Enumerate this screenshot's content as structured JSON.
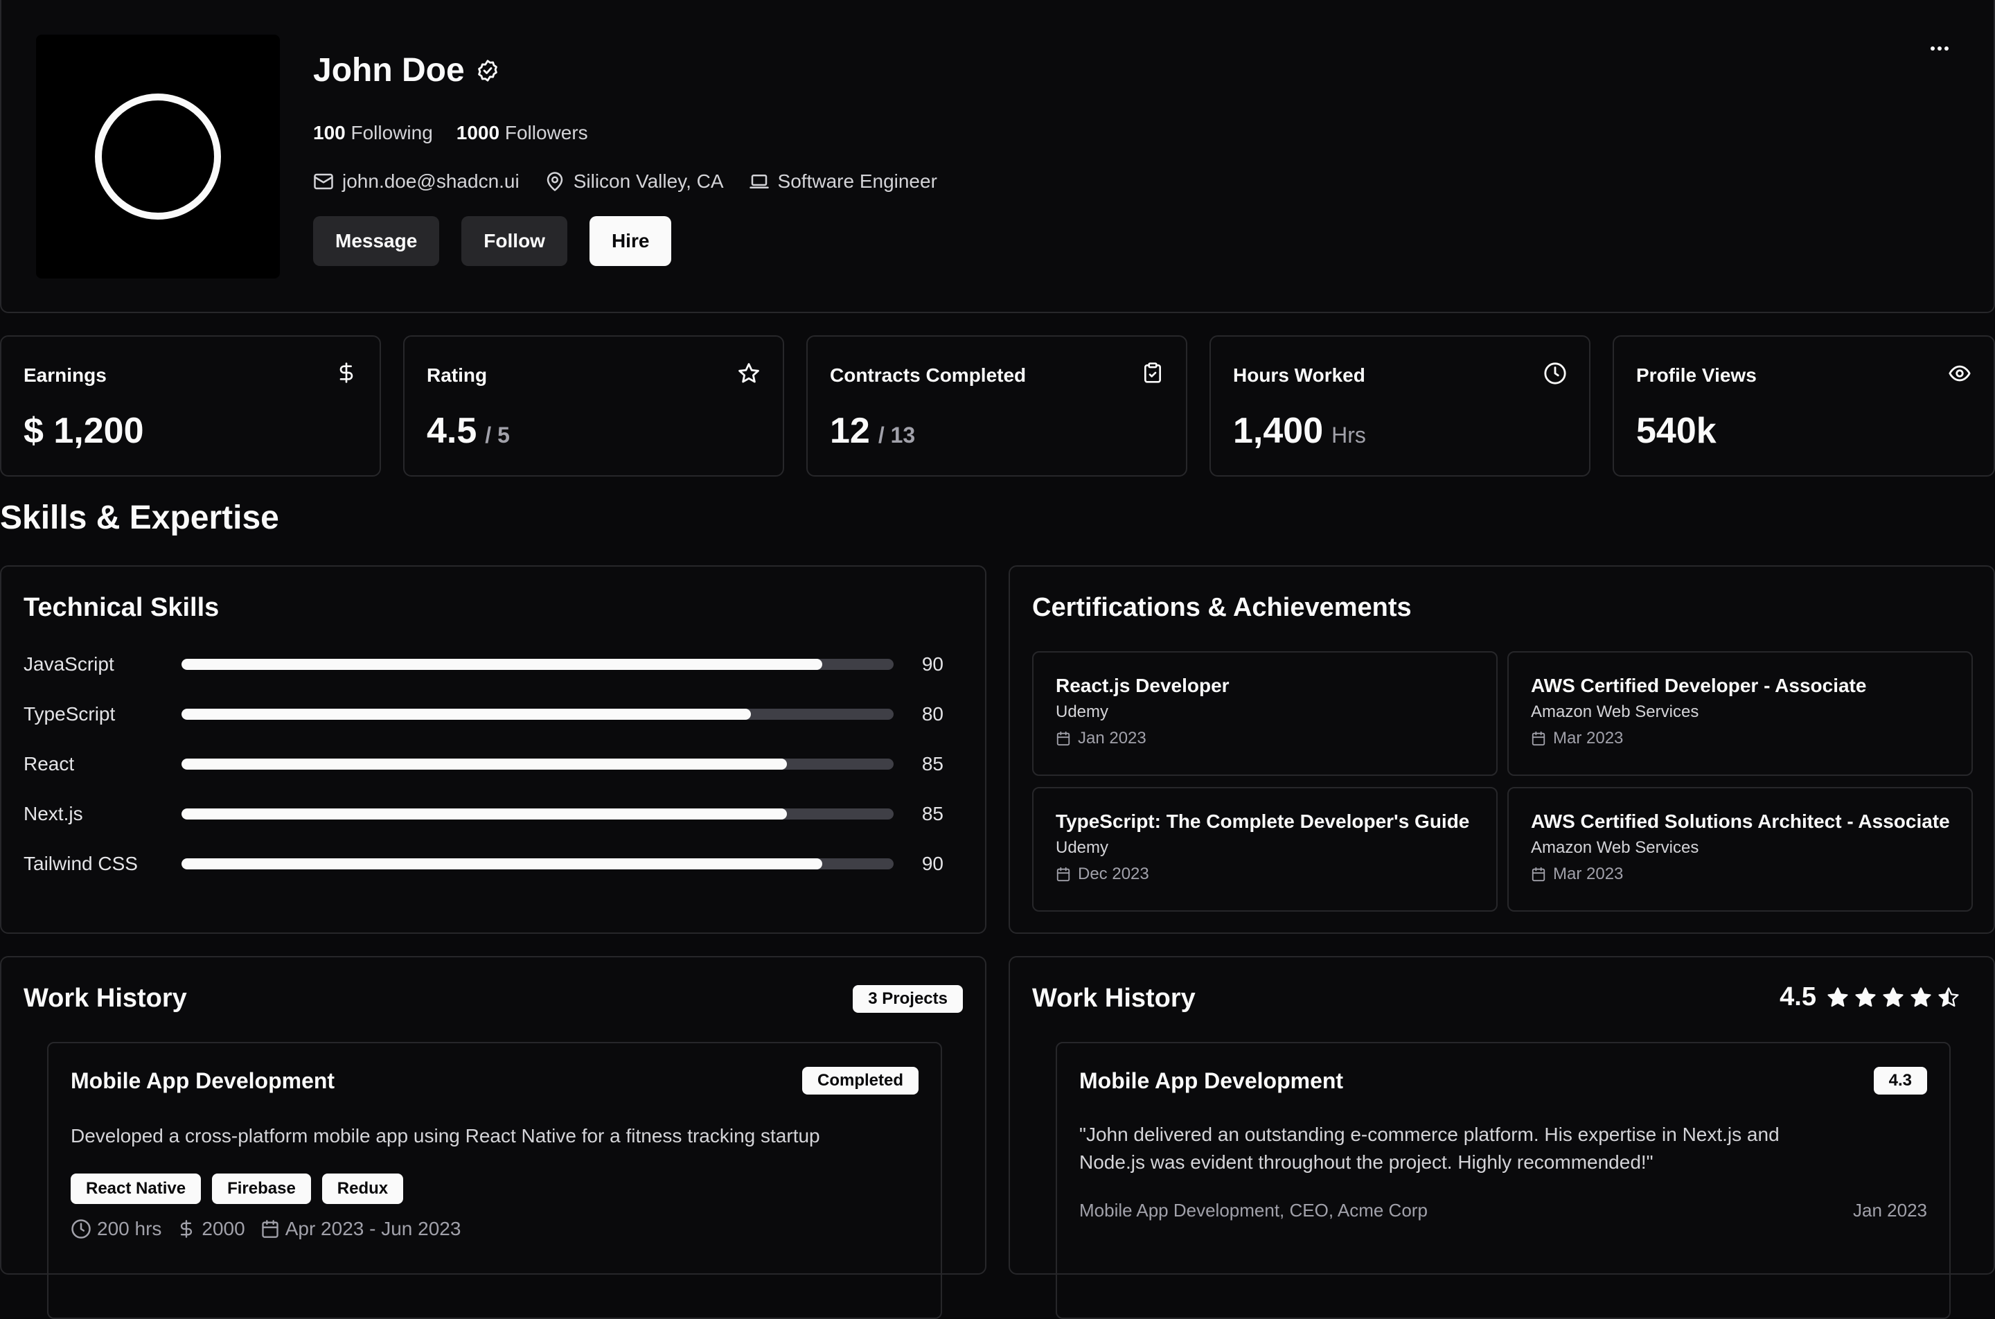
{
  "profile": {
    "name": "John Doe",
    "following_count": "100",
    "following_label": "Following",
    "followers_count": "1000",
    "followers_label": "Followers",
    "email": "john.doe@shadcn.ui",
    "location": "Silicon Valley, CA",
    "role": "Software Engineer",
    "buttons": {
      "message": "Message",
      "follow": "Follow",
      "hire": "Hire"
    }
  },
  "stats": [
    {
      "label": "Earnings",
      "value": "$ 1,200",
      "suffix": "",
      "icon": "dollar-icon"
    },
    {
      "label": "Rating",
      "value": "4.5",
      "suffix": "/ 5",
      "icon": "star-icon"
    },
    {
      "label": "Contracts Completed",
      "value": "12",
      "suffix": "/ 13",
      "icon": "clipboard-check-icon"
    },
    {
      "label": "Hours Worked",
      "value": "1,400",
      "suffix": "Hrs",
      "icon": "clock-icon"
    },
    {
      "label": "Profile Views",
      "value": "540k",
      "suffix": "",
      "icon": "eye-icon"
    }
  ],
  "section_title": "Skills & Expertise",
  "skills": {
    "title": "Technical Skills",
    "items": [
      {
        "name": "JavaScript",
        "level": 90,
        "label": "90"
      },
      {
        "name": "TypeScript",
        "level": 80,
        "label": "80"
      },
      {
        "name": "React",
        "level": 85,
        "label": "85"
      },
      {
        "name": "Next.js",
        "level": 85,
        "label": "85"
      },
      {
        "name": "Tailwind CSS",
        "level": 90,
        "label": "90"
      }
    ]
  },
  "certifications": {
    "title": "Certifications & Achievements",
    "items": [
      {
        "title": "React.js Developer",
        "org": "Udemy",
        "date": "Jan 2023"
      },
      {
        "title": "AWS Certified Developer - Associate",
        "org": "Amazon Web Services",
        "date": "Mar 2023"
      },
      {
        "title": "TypeScript: The Complete Developer's Guide",
        "org": "Udemy",
        "date": "Dec 2023"
      },
      {
        "title": "AWS Certified Solutions Architect - Associate",
        "org": "Amazon Web Services",
        "date": "Mar 2023"
      }
    ]
  },
  "work_history": {
    "title": "Work History",
    "badge": "3 Projects",
    "project": {
      "title": "Mobile App Development",
      "status": "Completed",
      "description": "Developed a cross-platform mobile app using React Native for a fitness tracking startup",
      "tags": [
        "React Native",
        "Firebase",
        "Redux"
      ],
      "hours": "200 hrs",
      "amount": "2000",
      "dates": "Apr 2023 - Jun 2023"
    }
  },
  "reviews": {
    "title": "Work History",
    "rating": "4.5",
    "stars_value": 4.5,
    "review": {
      "title": "Mobile App Development",
      "score": "4.3",
      "quote": "\"John delivered an outstanding e-commerce platform. His expertise in Next.js and Node.js was evident throughout the project. Highly recommended!\"",
      "from": "Mobile App Development, CEO, Acme Corp",
      "date": "Jan 2023"
    }
  }
}
